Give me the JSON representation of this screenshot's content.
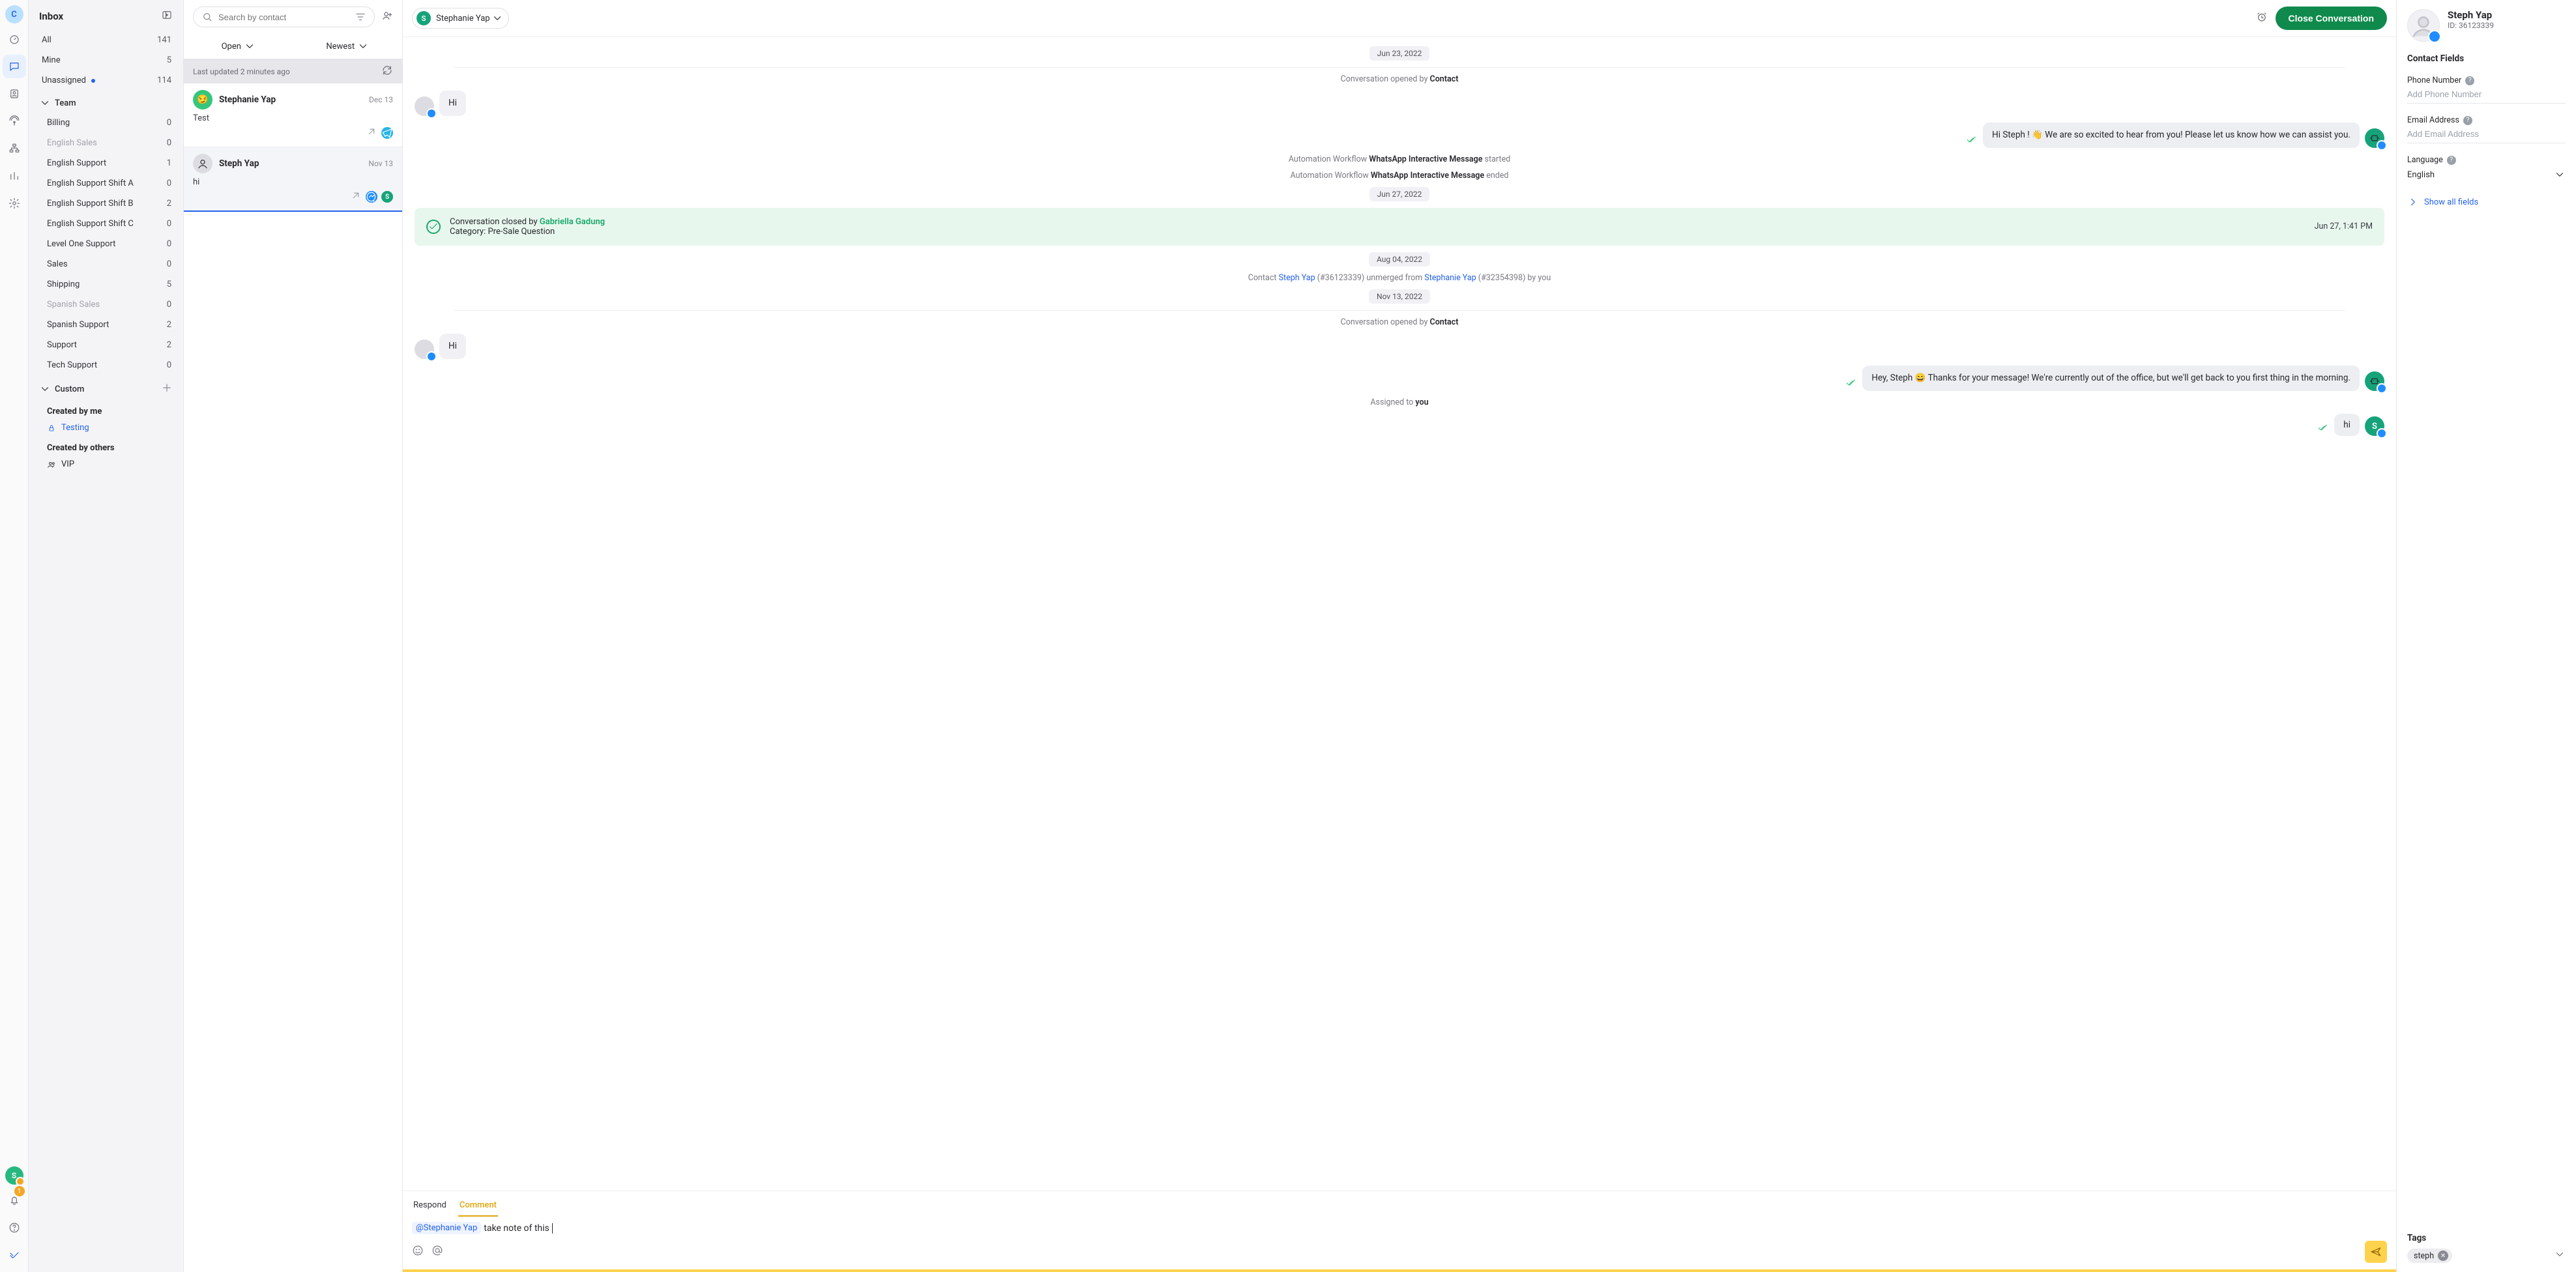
{
  "nav": {
    "workspace_initial": "C",
    "bell_badge": "1",
    "presence_initial": "S"
  },
  "inbox": {
    "title": "Inbox",
    "all": {
      "label": "All",
      "count": "141"
    },
    "mine": {
      "label": "Mine",
      "count": "5"
    },
    "unassigned": {
      "label": "Unassigned",
      "count": "114"
    },
    "team_label": "Team",
    "teams": [
      {
        "label": "Billing",
        "count": "0"
      },
      {
        "label": "English Sales",
        "count": "0",
        "muted": true
      },
      {
        "label": "English Support",
        "count": "1"
      },
      {
        "label": "English Support Shift A",
        "count": "0"
      },
      {
        "label": "English Support Shift B",
        "count": "2"
      },
      {
        "label": "English Support Shift C",
        "count": "0"
      },
      {
        "label": "Level One Support",
        "count": "0"
      },
      {
        "label": "Sales",
        "count": "0"
      },
      {
        "label": "Shipping",
        "count": "5"
      },
      {
        "label": "Spanish Sales",
        "count": "0",
        "muted": true
      },
      {
        "label": "Spanish Support",
        "count": "2"
      },
      {
        "label": "Support",
        "count": "2"
      },
      {
        "label": "Tech Support",
        "count": "0"
      }
    ],
    "custom_label": "Custom",
    "created_by_me": "Created by me",
    "testing_label": "Testing",
    "created_by_others": "Created by others",
    "vip_label": "VIP"
  },
  "list": {
    "search_placeholder": "Search by contact",
    "status_filter": "Open",
    "sort_filter": "Newest",
    "updated_text": "Last updated 2 minutes ago",
    "conversations": [
      {
        "name": "Stephanie Yap",
        "date": "Dec 13",
        "preview": "Test",
        "avatar_color": "green"
      },
      {
        "name": "Steph Yap",
        "date": "Nov 13",
        "preview": "hi",
        "avatar_color": "grey"
      }
    ]
  },
  "header": {
    "assignee": "Stephanie Yap",
    "close_label": "Close Conversation"
  },
  "thread": {
    "d1": "Jun 23, 2022",
    "opened_by": "Conversation opened by ",
    "opened_contact": "Contact",
    "m_hi": "Hi",
    "m_excited": "Hi Steph ! 👋 We are so excited to hear from you! Please let us know how we can assist you.",
    "auto_prefix": "Automation Workflow ",
    "auto_name": "WhatsApp Interactive Message",
    "auto_started": " started",
    "auto_ended": " ended",
    "d2": "Jun 27, 2022",
    "closed_prefix": "Conversation closed by ",
    "closed_by": "Gabriella Gadung",
    "category_label": "Category: ",
    "category_value": "Pre-Sale Question",
    "closed_time": "Jun 27, 1:41 PM",
    "d3": "Aug 04, 2022",
    "unmerge_p1": "Contact ",
    "unmerge_name1": "Steph Yap",
    "unmerge_p2": " (#36123339) unmerged from ",
    "unmerge_name2": "Stephanie Yap",
    "unmerge_p3": " (#32354398) by you",
    "d4": "Nov 13, 2022",
    "m_away": "Hey, Steph 😄 Thanks for your message! We're currently out of the office, but we'll get back to you first thing in the morning.",
    "assigned_prefix": "Assigned to ",
    "assigned_to": "you",
    "m_hi2": "hi"
  },
  "composer": {
    "tab_respond": "Respond",
    "tab_comment": "Comment",
    "mention": "@Stephanie Yap",
    "text": "take note of this"
  },
  "contact": {
    "name": "Steph Yap",
    "id_label": "ID: 36123339",
    "fields_title": "Contact Fields",
    "phone_label": "Phone Number",
    "phone_placeholder": "Add Phone Number",
    "email_label": "Email Address",
    "email_placeholder": "Add Email Address",
    "language_label": "Language",
    "language_value": "English",
    "show_all": "Show all fields",
    "tags_title": "Tags",
    "tag1": "steph"
  }
}
